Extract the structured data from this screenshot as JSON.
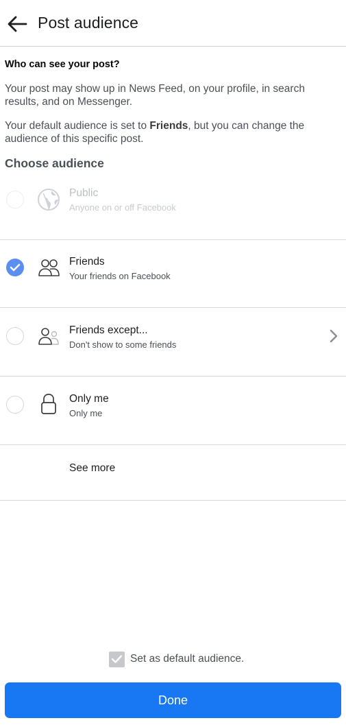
{
  "header": {
    "title": "Post audience",
    "back_icon": "arrow-left-icon"
  },
  "intro": {
    "question": "Who can see your post?",
    "description": "Your post may show up in News Feed, on your profile, in search results, and on Messenger.",
    "default_prefix": "Your default audience is set to ",
    "default_value": "Friends",
    "default_suffix": ", but you can change the audience of this specific post."
  },
  "choose_label": "Choose audience",
  "options": [
    {
      "title": "Public",
      "subtitle": "Anyone on or off Facebook",
      "icon": "globe-icon",
      "selected": false,
      "disabled": true
    },
    {
      "title": "Friends",
      "subtitle": "Your friends on Facebook",
      "icon": "friends-icon",
      "selected": true,
      "disabled": false
    },
    {
      "title": "Friends except...",
      "subtitle": "Don't show to some friends",
      "icon": "friends-except-icon",
      "selected": false,
      "disabled": false
    },
    {
      "title": "Only me",
      "subtitle": "Only me",
      "icon": "lock-icon",
      "selected": false,
      "disabled": false
    }
  ],
  "see_more": "See more",
  "footer": {
    "default_label": "Set as default audience.",
    "default_checked": true,
    "done_label": "Done"
  },
  "colors": {
    "accent": "#1877f2",
    "radio_selected": "#5b8ef0",
    "checkbox": "#c6c8cc"
  }
}
